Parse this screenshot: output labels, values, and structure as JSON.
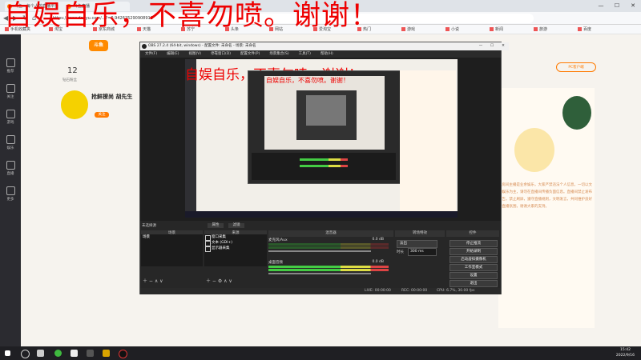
{
  "browser": {
    "tabs": [
      "斗鱼 - 每个人的直播平台",
      "斗鱼直播"
    ],
    "url": "https://www.douyu.com/...?=0.942625290908911",
    "window_buttons": [
      "—",
      "☐",
      "✕"
    ],
    "bookmarks": [
      "手机收藏夹",
      "淘宝",
      "京东商城",
      "天猫",
      "苏宁",
      "头条",
      "网站",
      "爱淘宝",
      "热门",
      "游戏",
      "小说",
      "新闻",
      "旅游",
      "百度"
    ]
  },
  "banner": {
    "text": "自娱自乐，不喜勿喷。谢谢！"
  },
  "left_sidebar": {
    "items": [
      "推荐",
      "关注",
      "游戏",
      "娱乐",
      "直播",
      "更多"
    ]
  },
  "page": {
    "logo": "斗鱼",
    "stat_number": "12",
    "stat_label": "钻石粉丝",
    "streamer_name": "抢鲜撩尚 胡先生",
    "follow_btn": "关注",
    "pc_client_btn": "PC客户端",
    "right_text": "本房间主播是业余娱乐，大家严禁违法个人信息，一切以文明娱乐为主，请勿在直播间传播负面信息。直播间禁止发布广告，禁止刷屏，遵守直播规则，文明发言，共同维护良好的直播氛围，谢谢大家的支持。"
  },
  "obs": {
    "title": "OBS 27.2.4 (64-bit, windows) - 配置文件: 未命名 - 场景: 未命名",
    "menu": [
      "文件(F)",
      "编辑(E)",
      "视图(V)",
      "停靠窗口(D)",
      "配置文件(P)",
      "场景集合(S)",
      "工具(T)",
      "帮助(H)"
    ],
    "preview_title": "自娱自乐，不喜勿喷。谢谢！",
    "nested_title": "自娱自乐，不喜勿喷。谢谢！",
    "no_source": "未选择源",
    "source_tabs": [
      "属性",
      "滤镜"
    ],
    "docks": {
      "scenes": "场景",
      "sources": "来源",
      "mixer": "混音器",
      "transitions": "转场特效",
      "controls": "控件"
    },
    "scene_items": [
      "场景"
    ],
    "source_items": [
      "窗口采集",
      "文本 (GDI+)",
      "显示器采集"
    ],
    "mixer": [
      {
        "name": "麦克风/Aux",
        "db": "0.0 dB"
      },
      {
        "name": "桌面音频",
        "db": "0.0 dB"
      }
    ],
    "transition": {
      "value": "淡出",
      "duration_label": "时长",
      "duration": "300 ms"
    },
    "controls": [
      "停止推流",
      "开始录制",
      "启动虚拟摄像机",
      "工作室模式",
      "设置",
      "退出"
    ],
    "status": {
      "live": "LIVE: 00:00:00",
      "rec": "REC: 00:00:00",
      "cpu": "CPU: 6.7%, 30.00 fps"
    }
  },
  "taskbar": {
    "time": "15:42",
    "date": "2022/9/16"
  },
  "colors": {
    "banner": "#ee0000",
    "accent": "#ff7a00",
    "obs_bg": "#1e1e1e"
  }
}
